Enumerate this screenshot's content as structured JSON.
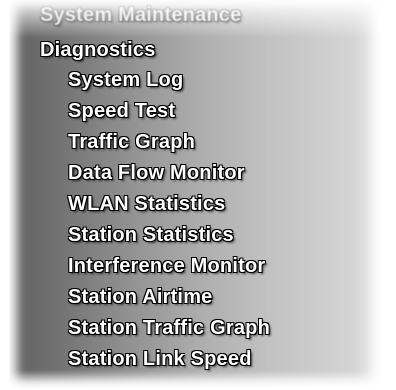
{
  "menu": {
    "parent_label": "System Maintenance",
    "section_label": "Diagnostics",
    "items": [
      {
        "label": "System Log"
      },
      {
        "label": "Speed Test"
      },
      {
        "label": "Traffic Graph"
      },
      {
        "label": "Data Flow Monitor"
      },
      {
        "label": "WLAN Statistics"
      },
      {
        "label": "Station Statistics"
      },
      {
        "label": "Interference Monitor"
      },
      {
        "label": "Station Airtime"
      },
      {
        "label": "Station Traffic Graph"
      },
      {
        "label": "Station Link Speed"
      }
    ]
  },
  "colors": {
    "text": "#ffffff",
    "text_outline": "#000000",
    "panel_dark": "#606060",
    "panel_light": "#dadada"
  }
}
